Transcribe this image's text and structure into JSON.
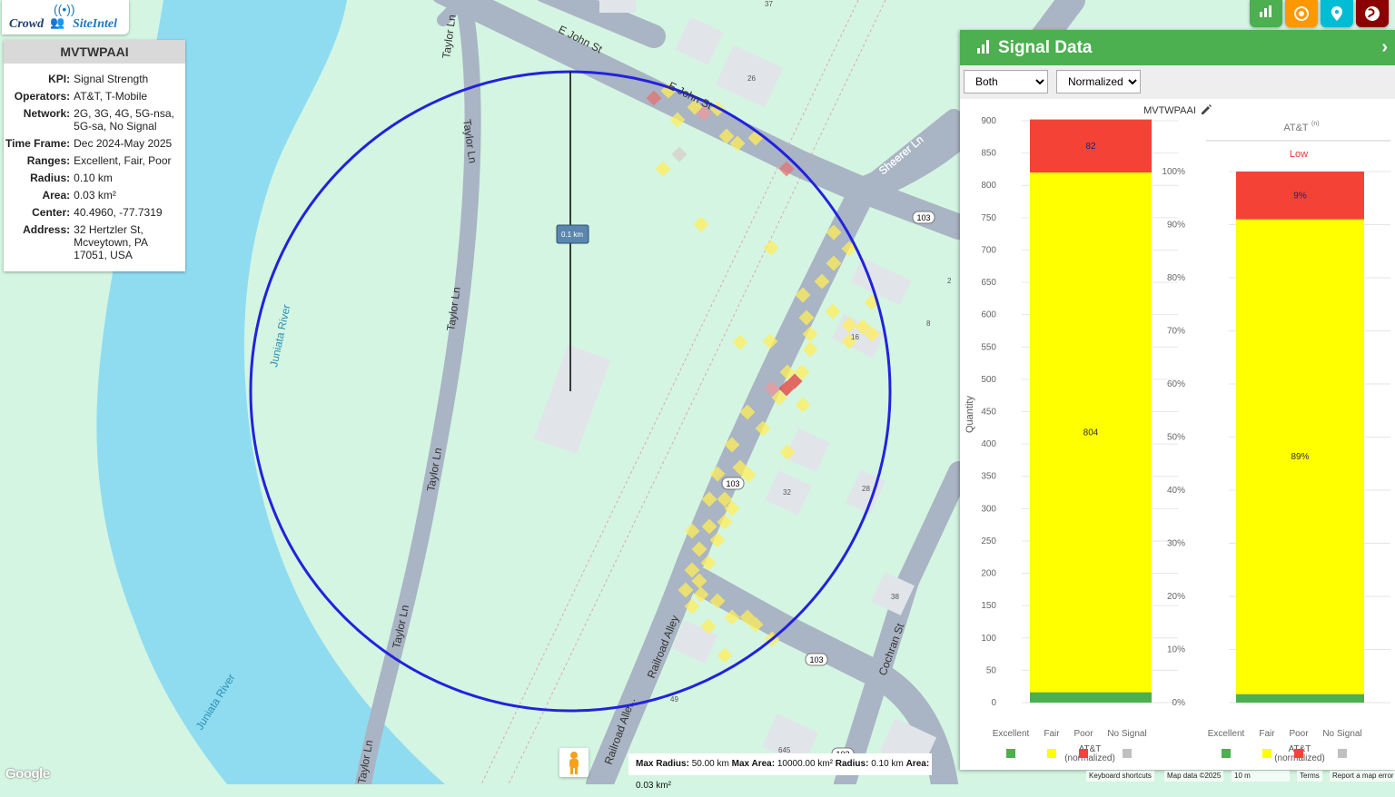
{
  "logo": {
    "part1": "Crowd",
    "part2": "SiteIntel"
  },
  "info_panel": {
    "title": "MVTWPAAI",
    "rows": [
      {
        "key": "KPI:",
        "value": "Signal Strength"
      },
      {
        "key": "Operators:",
        "value": "AT&T, T-Mobile"
      },
      {
        "key": "Network:",
        "value": "2G, 3G, 4G, 5G-nsa, 5G-sa, No Signal"
      },
      {
        "key": "Time Frame:",
        "value": "Dec 2024-May 2025"
      },
      {
        "key": "Ranges:",
        "value": "Excellent, Fair, Poor"
      },
      {
        "key": "Radius:",
        "value": "0.10 km"
      },
      {
        "key": "Area:",
        "value": "0.03 km²"
      },
      {
        "key": "Center:",
        "value": "40.4960, -77.7319"
      },
      {
        "key": "Address:",
        "value": "32 Hertzler St, Mcveytown, PA 17051, USA"
      }
    ]
  },
  "toolbar": {
    "buttons": [
      {
        "name": "chart",
        "color": "#4caf50"
      },
      {
        "name": "target",
        "color": "#ff9800"
      },
      {
        "name": "location-pin",
        "color": "#00bcd4"
      },
      {
        "name": "globe-pin",
        "color": "#8b0000"
      }
    ]
  },
  "map": {
    "radius_label": "0.1 km",
    "labels": {
      "river1": "Juniata River",
      "river2": "Juniata River",
      "taylor1": "Taylor Ln",
      "taylor2": "Taylor Ln",
      "taylor3": "Taylor Ln",
      "taylor4": "Taylor Ln",
      "taylor5": "Taylor Ln",
      "taylor6": "Taylor Ln",
      "ejohn1": "E John St",
      "ejohn2": "E John St",
      "sheerer": "Sheerer Ln",
      "cochran": "Cochran St",
      "railroad1": "Railroad Alley",
      "railroad2": "Railroad Alle...",
      "route1": "103",
      "route2": "103",
      "route3": "103",
      "route4": "103",
      "n37": "37",
      "n26": "26",
      "n2": "2",
      "n8": "8",
      "n16": "16",
      "n32": "32",
      "n28": "28",
      "n38": "38",
      "n49": "49",
      "n645": "645"
    }
  },
  "bottom_bar": {
    "max_radius_label": "Max Radius:",
    "max_radius": "50.00 km",
    "max_area_label": "Max Area:",
    "max_area": "10000.00 km²",
    "radius_label": "Radius:",
    "radius": "0.10 km",
    "area_label": "Area:",
    "area": "0.03 km²"
  },
  "attribution": {
    "google": "Google",
    "shortcuts": "Keyboard shortcuts",
    "map_data": "Map data ©2025",
    "scale": "10 m",
    "terms": "Terms",
    "report": "Report a map error"
  },
  "signal_panel": {
    "title": "Signal Data",
    "select_network": "Both",
    "select_mode": "Normalized",
    "chart_title": "MVTWPAAI",
    "right_title": "AT&T",
    "right_title_sup": "(n)",
    "right_badge": "Low",
    "legend": [
      {
        "label": "Excellent",
        "color": "#4caf50"
      },
      {
        "label": "Fair",
        "color": "#ffff00"
      },
      {
        "label": "Poor",
        "color": "#f44336"
      },
      {
        "label": "No Signal",
        "color": "#c0c0c0"
      }
    ]
  },
  "chart_data": [
    {
      "type": "bar",
      "title": "MVTWPAAI",
      "ylabel": "Quantity",
      "ylim": [
        0,
        900
      ],
      "yticks": [
        0,
        50,
        100,
        150,
        200,
        250,
        300,
        350,
        400,
        450,
        500,
        550,
        600,
        650,
        700,
        750,
        800,
        850,
        900
      ],
      "categories": [
        "AT&T (normalized)"
      ],
      "category_lines": [
        "AT&T",
        "(normalized)"
      ],
      "stacked": true,
      "series": [
        {
          "name": "Excellent",
          "values": [
            16
          ],
          "color": "#4caf50"
        },
        {
          "name": "Fair",
          "values": [
            804
          ],
          "color": "#ffff00",
          "label": "804"
        },
        {
          "name": "Poor",
          "values": [
            82
          ],
          "color": "#f44336",
          "label": "82"
        },
        {
          "name": "No Signal",
          "values": [
            0
          ],
          "color": "#c0c0c0"
        }
      ]
    },
    {
      "type": "bar",
      "title": "AT&T",
      "ylim": [
        0,
        100
      ],
      "yticks": [
        "0%",
        "10%",
        "20%",
        "30%",
        "40%",
        "50%",
        "60%",
        "70%",
        "80%",
        "90%",
        "100%"
      ],
      "categories": [
        "AT&T (normalized)"
      ],
      "category_lines": [
        "AT&T",
        "(normalized)"
      ],
      "stacked": true,
      "series": [
        {
          "name": "Excellent",
          "values": [
            1.6
          ],
          "color": "#4caf50"
        },
        {
          "name": "Fair",
          "values": [
            89.4
          ],
          "color": "#ffff00",
          "label": "89%"
        },
        {
          "name": "Poor",
          "values": [
            9
          ],
          "color": "#f44336",
          "label": "9%"
        },
        {
          "name": "No Signal",
          "values": [
            0
          ],
          "color": "#c0c0c0"
        }
      ]
    }
  ]
}
